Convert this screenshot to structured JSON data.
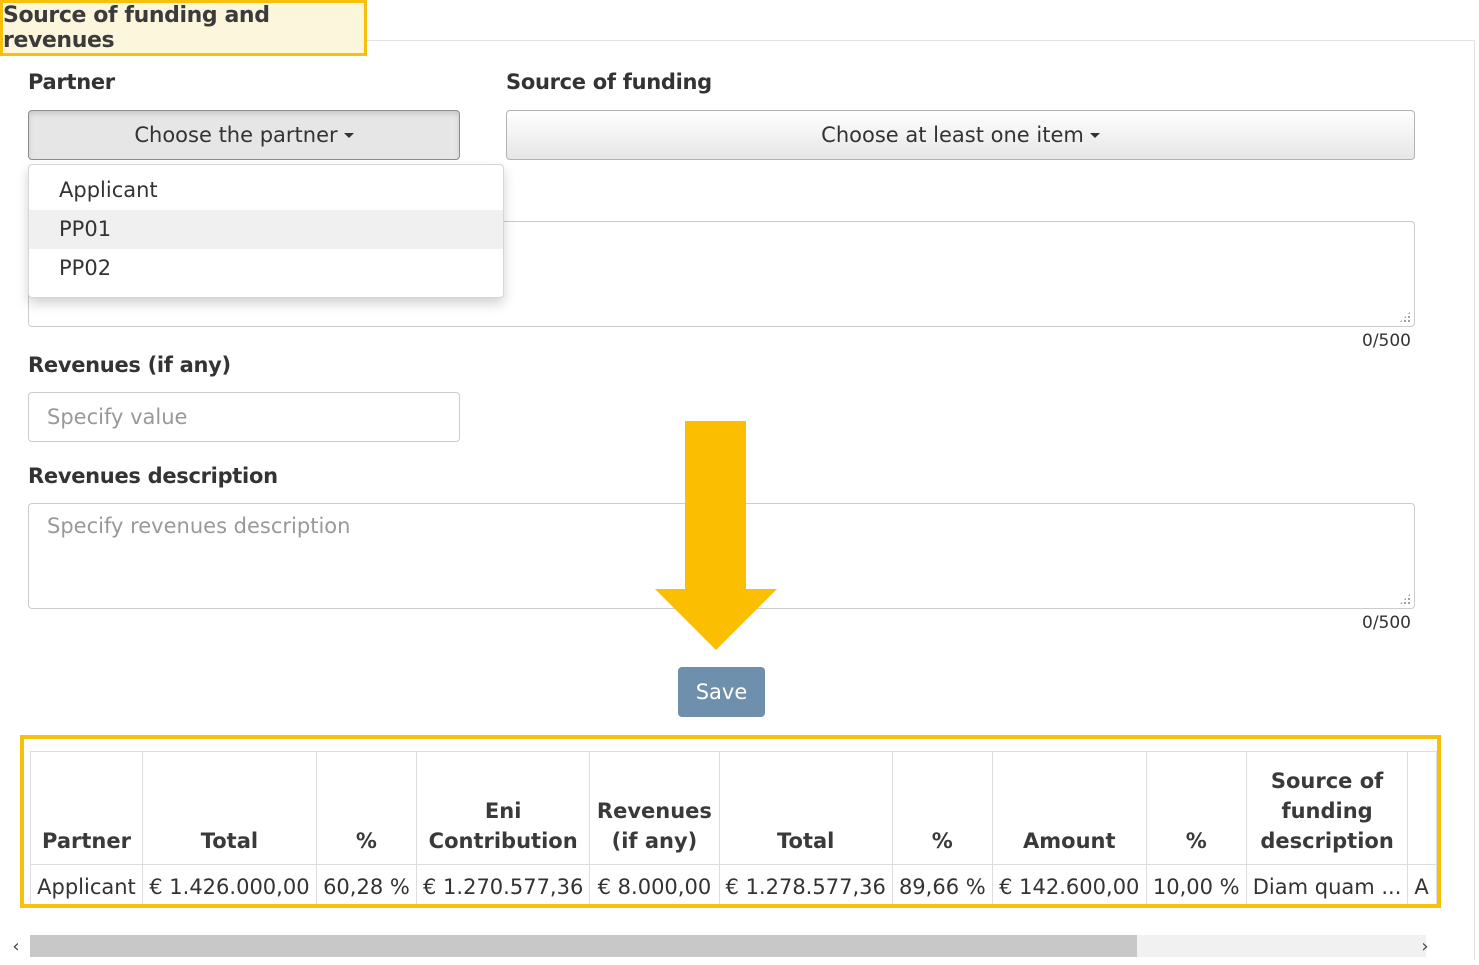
{
  "section_title": "Source of funding and revenues",
  "partner": {
    "label": "Partner",
    "button": "Choose the partner",
    "options": [
      "Applicant",
      "PP01",
      "PP02"
    ]
  },
  "funding": {
    "label": "Source of funding",
    "button": "Choose at least one item"
  },
  "funding_description": {
    "counter": "0/500"
  },
  "revenues": {
    "label": "Revenues (if any)",
    "placeholder": "Specify value"
  },
  "revenues_description": {
    "label": "Revenues description",
    "placeholder": "Specify revenues description",
    "counter": "0/500"
  },
  "save_label": "Save",
  "table": {
    "headers": [
      "Partner",
      "Total",
      "%",
      "Eni Contribution",
      "Revenues (if any)",
      "Total",
      "%",
      "Amount",
      "%",
      "Source of funding description",
      ""
    ],
    "row": [
      "Applicant",
      "€ 1.426.000,00",
      "60,28 %",
      "€ 1.270.577,36",
      "€ 8.000,00",
      "€ 1.278.577,36",
      "89,66 %",
      "€ 142.600,00",
      "10,00 %",
      "Diam quam ...",
      "A"
    ]
  },
  "scroll": {
    "left_arrow": "‹",
    "right_arrow": "›"
  },
  "colors": {
    "highlight": "#f7c10b",
    "arrow": "#fbbe00",
    "save_button": "#6f90ad"
  }
}
